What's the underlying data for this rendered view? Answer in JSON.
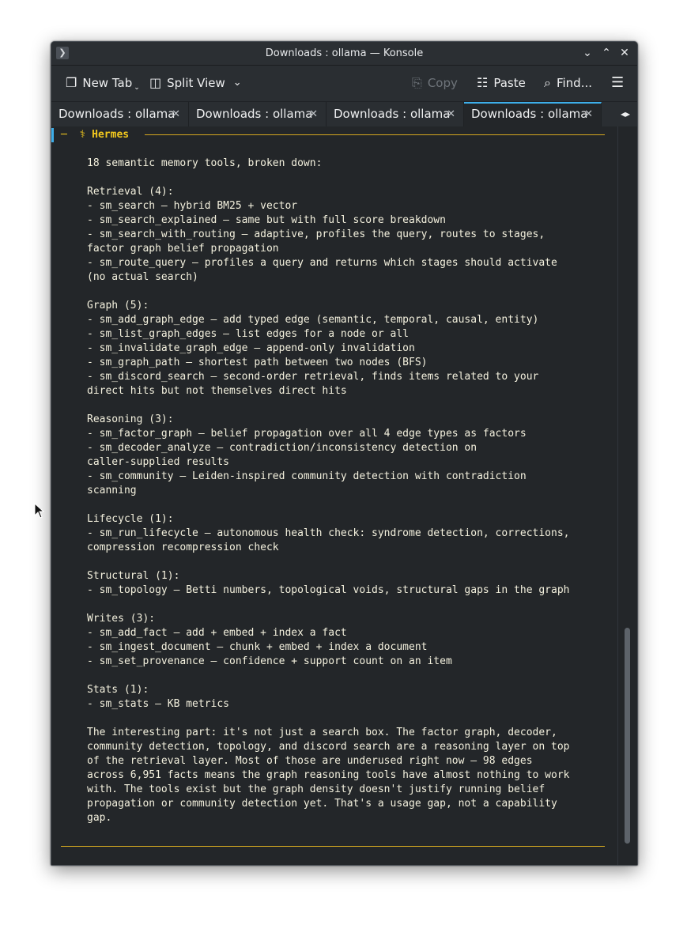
{
  "window": {
    "title": "Downloads : ollama — Konsole",
    "app_icon": "terminal-prompt-icon",
    "controls": [
      "chevron-down-icon",
      "chevron-up-icon",
      "close-icon"
    ]
  },
  "toolbar": {
    "new_tab": "New Tab",
    "split_view": "Split View",
    "copy": "Copy",
    "paste": "Paste",
    "find": "Find...",
    "menu_icon": "hamburger-menu-icon"
  },
  "tabs": [
    {
      "label": "Downloads : ollama",
      "active": false
    },
    {
      "label": "Downloads : ollama",
      "active": false
    },
    {
      "label": "Downloads : ollama",
      "active": false
    },
    {
      "label": "Downloads : ollama",
      "active": true
    }
  ],
  "terminal": {
    "header_dash": "─",
    "header_glyph": "⚕",
    "header_name": "Hermes",
    "accent_color": "#f2c81e",
    "lines": [
      "18 semantic memory tools, broken down:",
      "",
      "Retrieval (4):",
      "- sm_search — hybrid BM25 + vector",
      "- sm_search_explained — same but with full score breakdown",
      "- sm_search_with_routing — adaptive, profiles the query, routes to stages,",
      "factor graph belief propagation",
      "- sm_route_query — profiles a query and returns which stages should activate",
      "(no actual search)",
      "",
      "Graph (5):",
      "- sm_add_graph_edge — add typed edge (semantic, temporal, causal, entity)",
      "- sm_list_graph_edges — list edges for a node or all",
      "- sm_invalidate_graph_edge — append-only invalidation",
      "- sm_graph_path — shortest path between two nodes (BFS)",
      "- sm_discord_search — second-order retrieval, finds items related to your",
      "direct hits but not themselves direct hits",
      "",
      "Reasoning (3):",
      "- sm_factor_graph — belief propagation over all 4 edge types as factors",
      "- sm_decoder_analyze — contradiction/inconsistency detection on",
      "caller-supplied results",
      "- sm_community — Leiden-inspired community detection with contradiction",
      "scanning",
      "",
      "Lifecycle (1):",
      "- sm_run_lifecycle — autonomous health check: syndrome detection, corrections,",
      "compression recompression check",
      "",
      "Structural (1):",
      "- sm_topology — Betti numbers, topological voids, structural gaps in the graph",
      "",
      "Writes (3):",
      "- sm_add_fact — add + embed + index a fact",
      "- sm_ingest_document — chunk + embed + index a document",
      "- sm_set_provenance — confidence + support count on an item",
      "",
      "Stats (1):",
      "- sm_stats — KB metrics",
      "",
      "The interesting part: it's not just a search box. The factor graph, decoder,",
      "community detection, topology, and discord search are a reasoning layer on top",
      "of the retrieval layer. Most of those are underused right now — 98 edges",
      "across 6,951 facts means the graph reasoning tools have almost nothing to work",
      "with. The tools exist but the graph density doesn't justify running belief",
      "propagation or community detection yet. That's a usage gap, not a capability",
      "gap."
    ]
  }
}
